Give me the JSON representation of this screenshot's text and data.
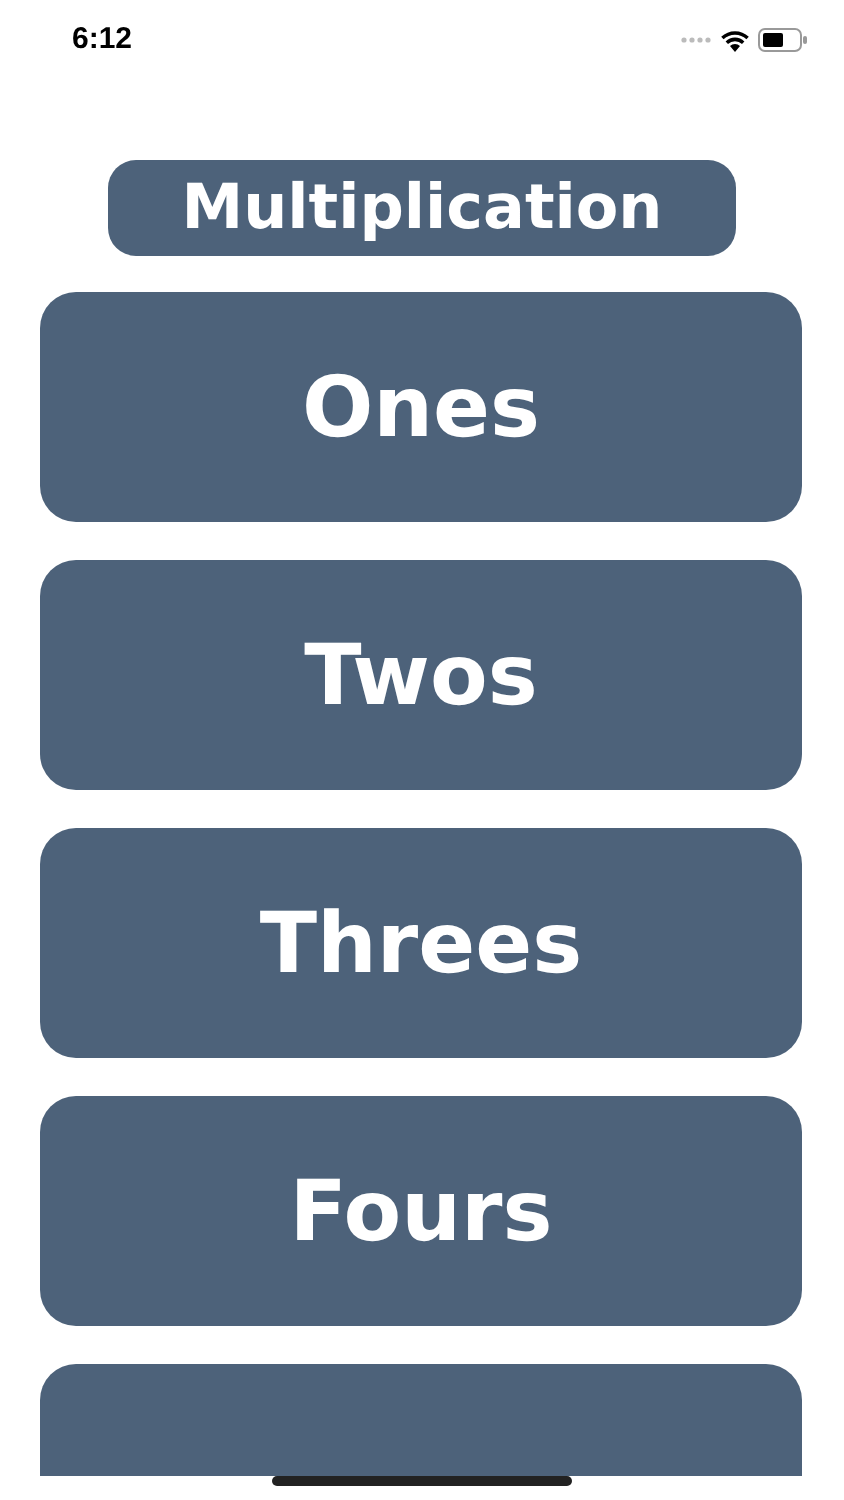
{
  "status_bar": {
    "time": "6:12"
  },
  "title": "Multiplication",
  "buttons": [
    {
      "label": "Ones"
    },
    {
      "label": "Twos"
    },
    {
      "label": "Threes"
    },
    {
      "label": "Fours"
    },
    {
      "kind": "cut_off"
    }
  ]
}
